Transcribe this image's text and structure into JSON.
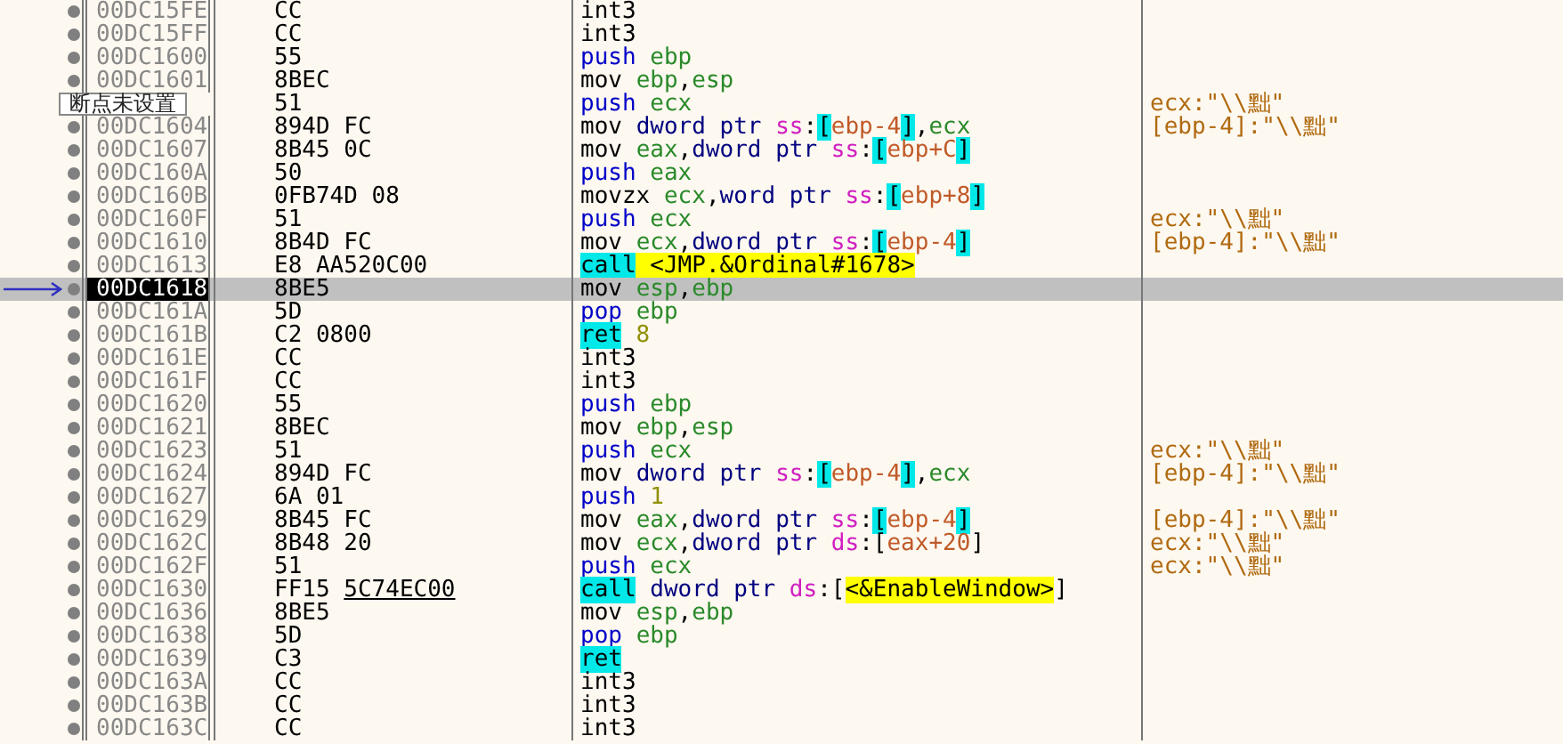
{
  "rows": [
    {
      "address": "00DC15FE",
      "bytes": "CC",
      "selected": false,
      "current": false,
      "instruction": [
        {
          "text": "int3",
          "kind": "op"
        }
      ]
    },
    {
      "address": "00DC15FF",
      "bytes": "CC",
      "selected": false,
      "current": false,
      "instruction": [
        {
          "text": "int3",
          "kind": "op"
        }
      ]
    },
    {
      "address": "00DC1600",
      "bytes": "55",
      "selected": false,
      "current": false,
      "instruction": [
        {
          "text": "push ",
          "kind": "stack"
        },
        {
          "text": "ebp",
          "kind": "reg"
        }
      ]
    },
    {
      "address": "00DC1601",
      "bytes": "8BEC",
      "selected": false,
      "current": false,
      "instruction": [
        {
          "text": "mov ",
          "kind": "op"
        },
        {
          "text": "ebp",
          "kind": "reg"
        },
        {
          "text": ",",
          "kind": "punct"
        },
        {
          "text": "esp",
          "kind": "reg"
        }
      ]
    },
    {
      "bytes": "51",
      "selected": false,
      "current": false,
      "instruction": [
        {
          "text": "push ",
          "kind": "stack"
        },
        {
          "text": "ecx",
          "kind": "reg"
        }
      ],
      "comment": "ecx:\"\\\\黜\""
    },
    {
      "address": "00DC1604",
      "bytes": "894D FC",
      "selected": false,
      "current": false,
      "instruction": [
        {
          "text": "mov ",
          "kind": "op"
        },
        {
          "text": "dword ptr ",
          "kind": "size"
        },
        {
          "text": "ss",
          "kind": "seg"
        },
        {
          "text": ":",
          "kind": "punct"
        },
        {
          "text": "[",
          "kind": "brk"
        },
        {
          "text": "ebp-4",
          "kind": "mem"
        },
        {
          "text": "]",
          "kind": "brk"
        },
        {
          "text": ",",
          "kind": "punct"
        },
        {
          "text": "ecx",
          "kind": "reg"
        }
      ],
      "comment": "[ebp-4]:\"\\\\黜\""
    },
    {
      "address": "00DC1607",
      "bytes": "8B45 0C",
      "selected": false,
      "current": false,
      "instruction": [
        {
          "text": "mov ",
          "kind": "op"
        },
        {
          "text": "eax",
          "kind": "reg"
        },
        {
          "text": ",",
          "kind": "punct"
        },
        {
          "text": "dword ptr ",
          "kind": "size"
        },
        {
          "text": "ss",
          "kind": "seg"
        },
        {
          "text": ":",
          "kind": "punct"
        },
        {
          "text": "[",
          "kind": "brk"
        },
        {
          "text": "ebp+C",
          "kind": "mem"
        },
        {
          "text": "]",
          "kind": "brk"
        }
      ]
    },
    {
      "address": "00DC160A",
      "bytes": "50",
      "selected": false,
      "current": false,
      "instruction": [
        {
          "text": "push ",
          "kind": "stack"
        },
        {
          "text": "eax",
          "kind": "reg"
        }
      ]
    },
    {
      "address": "00DC160B",
      "bytes": "0FB74D 08",
      "selected": false,
      "current": false,
      "instruction": [
        {
          "text": "movzx ",
          "kind": "op"
        },
        {
          "text": "ecx",
          "kind": "reg"
        },
        {
          "text": ",",
          "kind": "punct"
        },
        {
          "text": "word ptr ",
          "kind": "size"
        },
        {
          "text": "ss",
          "kind": "seg"
        },
        {
          "text": ":",
          "kind": "punct"
        },
        {
          "text": "[",
          "kind": "brk"
        },
        {
          "text": "ebp+8",
          "kind": "mem"
        },
        {
          "text": "]",
          "kind": "brk"
        }
      ]
    },
    {
      "address": "00DC160F",
      "bytes": "51",
      "selected": false,
      "current": false,
      "instruction": [
        {
          "text": "push ",
          "kind": "stack"
        },
        {
          "text": "ecx",
          "kind": "reg"
        }
      ],
      "comment": "ecx:\"\\\\黜\""
    },
    {
      "address": "00DC1610",
      "bytes": "8B4D FC",
      "selected": false,
      "current": false,
      "instruction": [
        {
          "text": "mov ",
          "kind": "op"
        },
        {
          "text": "ecx",
          "kind": "reg"
        },
        {
          "text": ",",
          "kind": "punct"
        },
        {
          "text": "dword ptr ",
          "kind": "size"
        },
        {
          "text": "ss",
          "kind": "seg"
        },
        {
          "text": ":",
          "kind": "punct"
        },
        {
          "text": "[",
          "kind": "brk"
        },
        {
          "text": "ebp-4",
          "kind": "mem"
        },
        {
          "text": "]",
          "kind": "brk"
        }
      ],
      "comment": "[ebp-4]:\"\\\\黜\""
    },
    {
      "address": "00DC1613",
      "bytes": "E8 AA520C00",
      "selected": false,
      "current": false,
      "instruction": [
        {
          "text": "call",
          "kind": "branch"
        },
        {
          "text": " <JMP.&Ordinal#1678>",
          "kind": "sym"
        }
      ]
    },
    {
      "address": "00DC1618",
      "bytes": "8BE5",
      "selected": true,
      "current": true,
      "instruction": [
        {
          "text": "mov ",
          "kind": "op"
        },
        {
          "text": "esp",
          "kind": "reg"
        },
        {
          "text": ",",
          "kind": "punct"
        },
        {
          "text": "ebp",
          "kind": "reg"
        }
      ]
    },
    {
      "address": "00DC161A",
      "bytes": "5D",
      "selected": false,
      "current": false,
      "instruction": [
        {
          "text": "pop ",
          "kind": "stack"
        },
        {
          "text": "ebp",
          "kind": "reg"
        }
      ]
    },
    {
      "address": "00DC161B",
      "bytes": "C2 0800",
      "selected": false,
      "current": false,
      "instruction": [
        {
          "text": "ret",
          "kind": "branch"
        },
        {
          "text": " 8",
          "kind": "imm"
        }
      ]
    },
    {
      "address": "00DC161E",
      "bytes": "CC",
      "selected": false,
      "current": false,
      "instruction": [
        {
          "text": "int3",
          "kind": "op"
        }
      ]
    },
    {
      "address": "00DC161F",
      "bytes": "CC",
      "selected": false,
      "current": false,
      "instruction": [
        {
          "text": "int3",
          "kind": "op"
        }
      ]
    },
    {
      "address": "00DC1620",
      "bytes": "55",
      "selected": false,
      "current": false,
      "instruction": [
        {
          "text": "push ",
          "kind": "stack"
        },
        {
          "text": "ebp",
          "kind": "reg"
        }
      ]
    },
    {
      "address": "00DC1621",
      "bytes": "8BEC",
      "selected": false,
      "current": false,
      "instruction": [
        {
          "text": "mov ",
          "kind": "op"
        },
        {
          "text": "ebp",
          "kind": "reg"
        },
        {
          "text": ",",
          "kind": "punct"
        },
        {
          "text": "esp",
          "kind": "reg"
        }
      ]
    },
    {
      "address": "00DC1623",
      "bytes": "51",
      "selected": false,
      "current": false,
      "instruction": [
        {
          "text": "push ",
          "kind": "stack"
        },
        {
          "text": "ecx",
          "kind": "reg"
        }
      ],
      "comment": "ecx:\"\\\\黜\""
    },
    {
      "address": "00DC1624",
      "bytes": "894D FC",
      "selected": false,
      "current": false,
      "instruction": [
        {
          "text": "mov ",
          "kind": "op"
        },
        {
          "text": "dword ptr ",
          "kind": "size"
        },
        {
          "text": "ss",
          "kind": "seg"
        },
        {
          "text": ":",
          "kind": "punct"
        },
        {
          "text": "[",
          "kind": "brk"
        },
        {
          "text": "ebp-4",
          "kind": "mem"
        },
        {
          "text": "]",
          "kind": "brk"
        },
        {
          "text": ",",
          "kind": "punct"
        },
        {
          "text": "ecx",
          "kind": "reg"
        }
      ],
      "comment": "[ebp-4]:\"\\\\黜\""
    },
    {
      "address": "00DC1627",
      "bytes": "6A 01",
      "selected": false,
      "current": false,
      "instruction": [
        {
          "text": "push",
          "kind": "stack"
        },
        {
          "text": " 1",
          "kind": "imm"
        }
      ]
    },
    {
      "address": "00DC1629",
      "bytes": "8B45 FC",
      "selected": false,
      "current": false,
      "instruction": [
        {
          "text": "mov ",
          "kind": "op"
        },
        {
          "text": "eax",
          "kind": "reg"
        },
        {
          "text": ",",
          "kind": "punct"
        },
        {
          "text": "dword ptr ",
          "kind": "size"
        },
        {
          "text": "ss",
          "kind": "seg"
        },
        {
          "text": ":",
          "kind": "punct"
        },
        {
          "text": "[",
          "kind": "brk"
        },
        {
          "text": "ebp-4",
          "kind": "mem"
        },
        {
          "text": "]",
          "kind": "brk"
        }
      ],
      "comment": "[ebp-4]:\"\\\\黜\""
    },
    {
      "address": "00DC162C",
      "bytes": "8B48 20",
      "selected": false,
      "current": false,
      "instruction": [
        {
          "text": "mov ",
          "kind": "op"
        },
        {
          "text": "ecx",
          "kind": "reg"
        },
        {
          "text": ",",
          "kind": "punct"
        },
        {
          "text": "dword ptr ",
          "kind": "size"
        },
        {
          "text": "ds",
          "kind": "seg"
        },
        {
          "text": ":[",
          "kind": "punct"
        },
        {
          "text": "eax+20",
          "kind": "mem"
        },
        {
          "text": "]",
          "kind": "punct"
        }
      ],
      "comment": "ecx:\"\\\\黜\""
    },
    {
      "address": "00DC162F",
      "bytes": "51",
      "selected": false,
      "current": false,
      "instruction": [
        {
          "text": "push ",
          "kind": "stack"
        },
        {
          "text": "ecx",
          "kind": "reg"
        }
      ],
      "comment": "ecx:\"\\\\黜\""
    },
    {
      "address": "00DC1630",
      "bytes": "FF15",
      "bytes_link": "5C74EC00",
      "selected": false,
      "current": false,
      "instruction": [
        {
          "text": "call",
          "kind": "branch"
        },
        {
          "text": " dword ptr ",
          "kind": "size"
        },
        {
          "text": "ds",
          "kind": "seg"
        },
        {
          "text": ":[",
          "kind": "punct"
        },
        {
          "text": "<&EnableWindow>",
          "kind": "sym"
        },
        {
          "text": "]",
          "kind": "punct"
        }
      ]
    },
    {
      "address": "00DC1636",
      "bytes": "8BE5",
      "selected": false,
      "current": false,
      "instruction": [
        {
          "text": "mov ",
          "kind": "op"
        },
        {
          "text": "esp",
          "kind": "reg"
        },
        {
          "text": ",",
          "kind": "punct"
        },
        {
          "text": "ebp",
          "kind": "reg"
        }
      ]
    },
    {
      "address": "00DC1638",
      "bytes": "5D",
      "selected": false,
      "current": false,
      "instruction": [
        {
          "text": "pop ",
          "kind": "stack"
        },
        {
          "text": "ebp",
          "kind": "reg"
        }
      ]
    },
    {
      "address": "00DC1639",
      "bytes": "C3",
      "selected": false,
      "current": false,
      "instruction": [
        {
          "text": "ret",
          "kind": "branch"
        }
      ]
    },
    {
      "address": "00DC163A",
      "bytes": "CC",
      "selected": false,
      "current": false,
      "instruction": [
        {
          "text": "int3",
          "kind": "op"
        }
      ]
    },
    {
      "address": "00DC163B",
      "bytes": "CC",
      "selected": false,
      "current": false,
      "instruction": [
        {
          "text": "int3",
          "kind": "op"
        }
      ]
    },
    {
      "address": "00DC163C",
      "bytes": "CC",
      "selected": false,
      "current": false,
      "instruction": [
        {
          "text": "int3",
          "kind": "op"
        }
      ]
    }
  ],
  "tooltip": {
    "text": "断点未设置"
  }
}
